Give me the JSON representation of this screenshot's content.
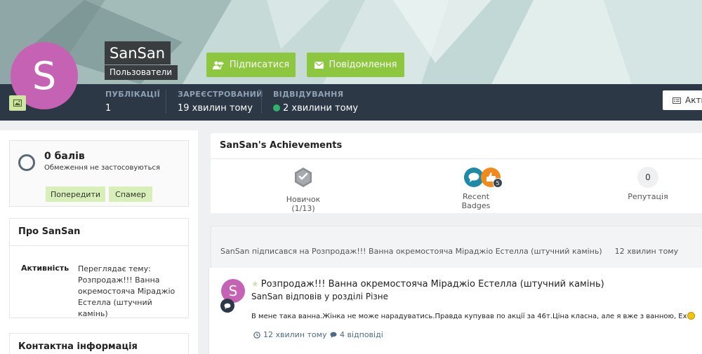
{
  "profile": {
    "name": "SanSan",
    "group": "Пользователи",
    "avatar_letter": "S",
    "avatar_color": "#c562b3"
  },
  "actions": {
    "follow_label": "Підписатися",
    "message_label": "Повідомлення",
    "activity_label": "Акти"
  },
  "stats": {
    "posts_label": "ПУБЛІКАЦІЇ",
    "posts_value": "1",
    "registered_label": "ЗАРЕЄСТРОВАНИЙ",
    "registered_value": "19 хвилин тому",
    "visited_label": "ВІДВІДУВАННЯ",
    "visited_value": "2 хвилини тому"
  },
  "reputation_card": {
    "title": "0 балів",
    "subtitle": "Обмеження не застосовуються",
    "warn_label": "Попередити",
    "spam_label": "Спамер"
  },
  "about": {
    "title": "Про SanSan",
    "activity_label": "Активність",
    "activity_value": "Переглядає тему: Розпродаж!!! Ванна окремостояча Міраджіо Естелла (штучний камінь)"
  },
  "contact": {
    "title": "Контактна інформація"
  },
  "achievements": {
    "title": "SanSan's Achievements",
    "rank_label": "Новичок (1/13)",
    "badges_label": "Recent Badges",
    "badge_count": "5",
    "reputation_label": "Репутація",
    "reputation_value": "0"
  },
  "feed": {
    "follow_text": "SanSan підписався на Розпродаж!!! Ванна окремостояча Міраджіо Естелла (штучний камінь)",
    "follow_time": "12 хвилин тому",
    "post_title": "Розпродаж!!! Ванна окремостояча Міраджіо Естелла (штучний камінь)",
    "post_subtitle": "SanSan відповів у розділі Різне",
    "post_body": "В мене така ванна.Жінка не може нарадуватись.Правда купував по акції за 46т.Ціна класна, але я вже з ванною, Ех",
    "post_time": "12 хвилин тому",
    "post_replies": "4 відповіді"
  },
  "colors": {
    "accent_green": "#8dc63f",
    "stats_bar": "#2c3846",
    "online": "#2fb36a"
  }
}
